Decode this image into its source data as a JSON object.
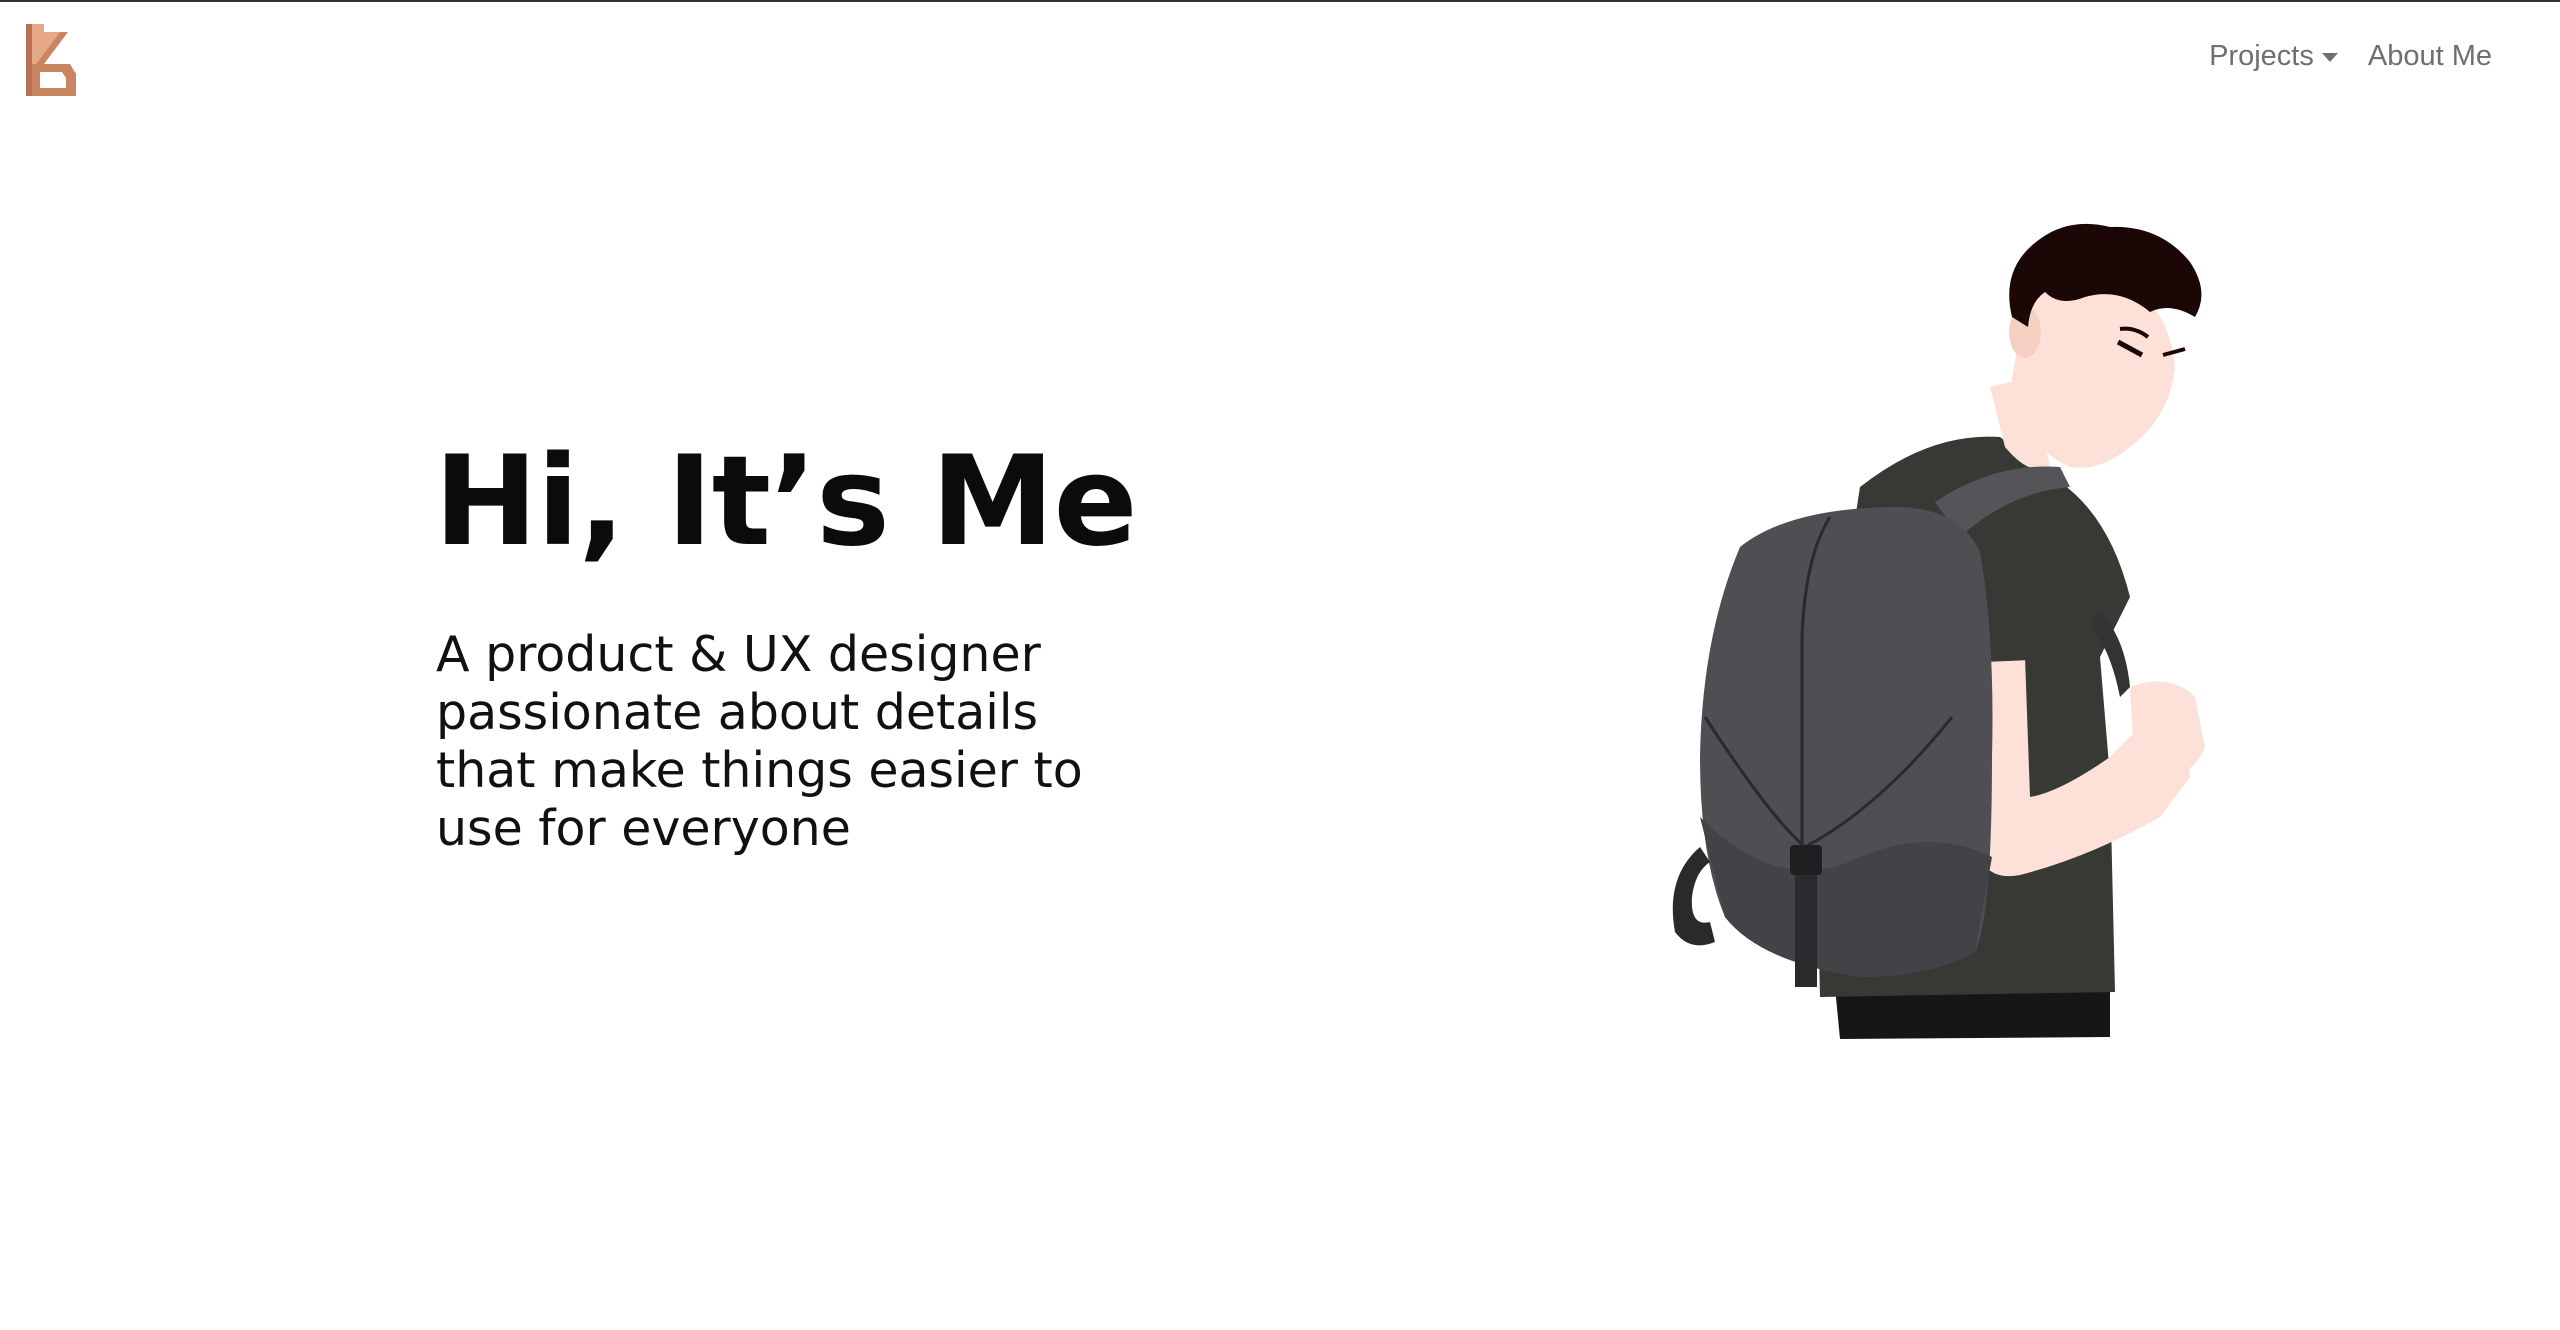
{
  "nav": {
    "projects_label": "Projects",
    "about_label": "About Me"
  },
  "hero": {
    "title": "Hi, It’s Me",
    "subtitle": "A product & UX designer passionate about details that make things easier to use for everyone"
  },
  "colors": {
    "logo": "#c98461",
    "nav_text": "#6f6f6f",
    "heading": "#0b0b0b",
    "shirt": "#373935",
    "backpack": "#4f4f53",
    "skin": "#fde1d9",
    "hair": "#1b0806"
  }
}
